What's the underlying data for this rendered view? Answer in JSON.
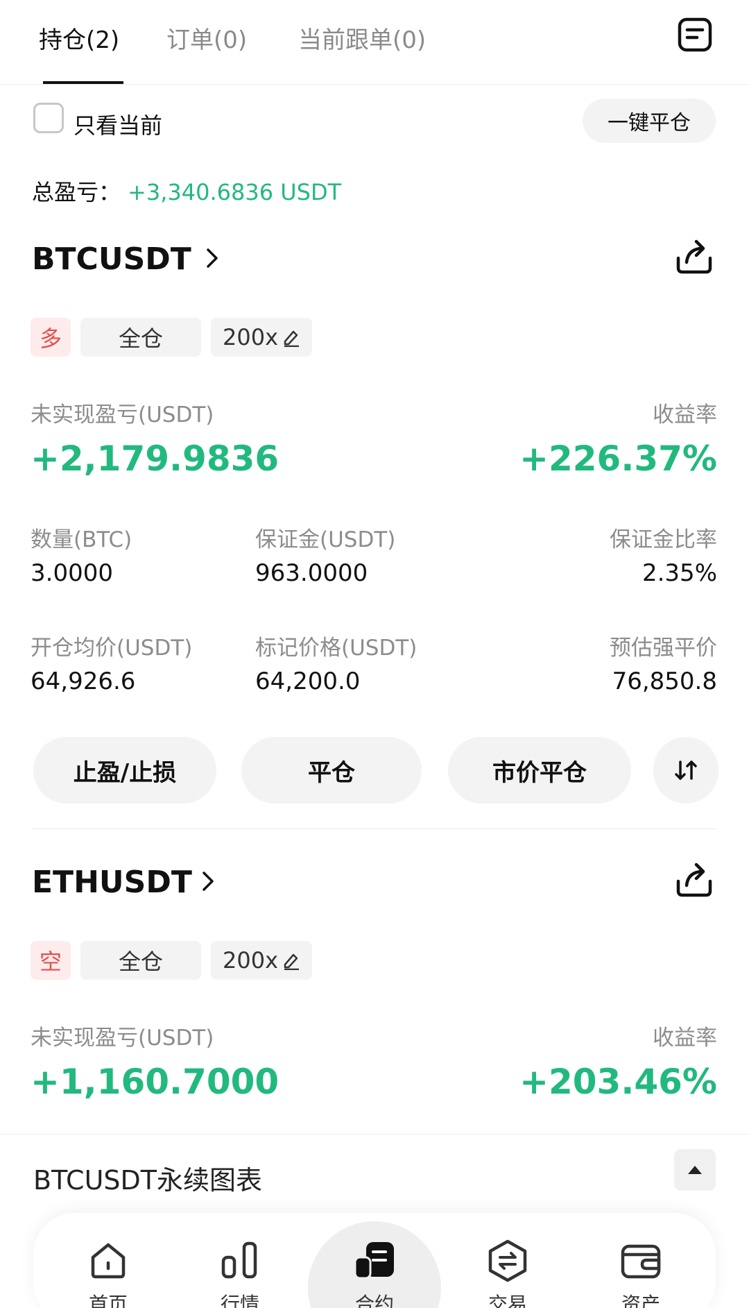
{
  "tabs": [
    {
      "label": "持仓(2)",
      "active": true
    },
    {
      "label": "订单(0)",
      "active": false
    },
    {
      "label": "当前跟单(0)",
      "active": false
    }
  ],
  "filter": {
    "label": "只看当前"
  },
  "close_all_label": "一键平仓",
  "total_pnl": {
    "label": "总盈亏：",
    "value": "+3,340.6836 USDT"
  },
  "positions": [
    {
      "symbol": "BTCUSDT",
      "side": "多",
      "margin_mode": "全仓",
      "leverage": "200x",
      "unrealized_label": "未实现盈亏(USDT)",
      "unrealized_value": "+2,179.9836",
      "roi_label": "收益率",
      "roi_value": "+226.37%",
      "qty_label": "数量(BTC)",
      "qty_value": "3.0000",
      "margin_label": "保证金(USDT)",
      "margin_value": "963.0000",
      "margin_ratio_label": "保证金比率",
      "margin_ratio_value": "2.35%",
      "entry_label": "开仓均价(USDT)",
      "entry_value": "64,926.6",
      "mark_label": "标记价格(USDT)",
      "mark_value": "64,200.0",
      "liq_label": "预估强平价",
      "liq_value": "76,850.8",
      "actions": [
        "止盈/止损",
        "平仓",
        "市价平仓"
      ]
    },
    {
      "symbol": "ETHUSDT",
      "side": "空",
      "margin_mode": "全仓",
      "leverage": "200x",
      "unrealized_label": "未实现盈亏(USDT)",
      "unrealized_value": "+1,160.7000",
      "roi_label": "收益率",
      "roi_value": "+203.46%"
    }
  ],
  "chart_section": {
    "title": "BTCUSDT永续图表"
  },
  "nav": [
    {
      "label": "首页",
      "icon": "home-icon"
    },
    {
      "label": "行情",
      "icon": "market-icon"
    },
    {
      "label": "合约",
      "icon": "contract-icon"
    },
    {
      "label": "交易",
      "icon": "trade-icon"
    },
    {
      "label": "资产",
      "icon": "wallet-icon"
    }
  ],
  "colors": {
    "profit": "#22b97e",
    "short": "#e2514b"
  }
}
